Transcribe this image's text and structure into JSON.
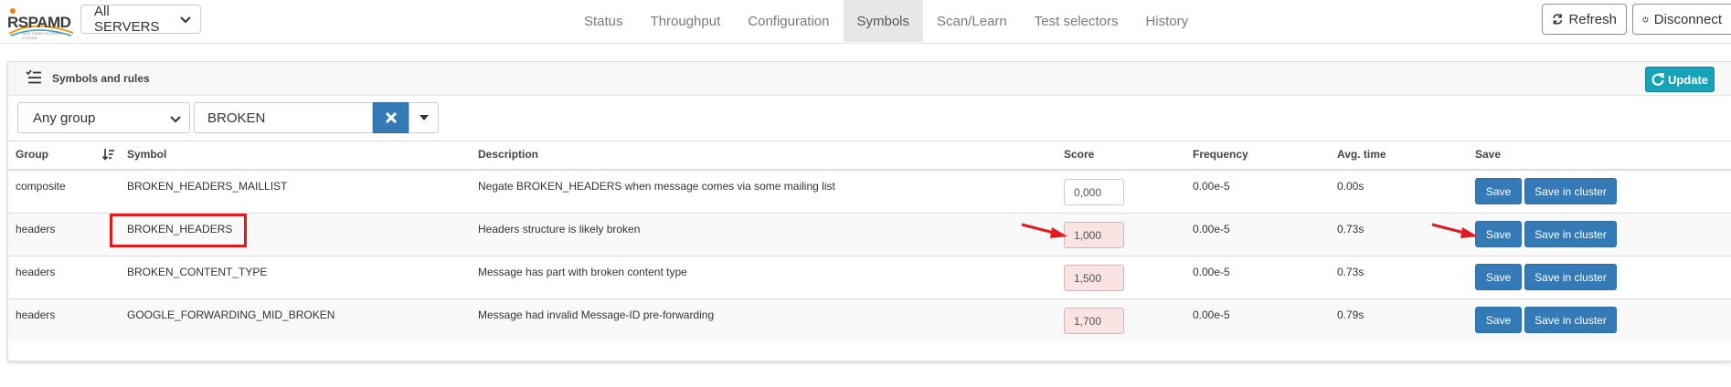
{
  "app": {
    "logo_text": "RSPAMD",
    "logo_sub": "FAST SPAM FILTERING SYSTEM"
  },
  "server_select": {
    "value": "All SERVERS"
  },
  "nav": {
    "tabs": [
      {
        "label": "Status"
      },
      {
        "label": "Throughput"
      },
      {
        "label": "Configuration"
      },
      {
        "label": "Symbols",
        "active": true
      },
      {
        "label": "Scan/Learn"
      },
      {
        "label": "Test selectors"
      },
      {
        "label": "History"
      }
    ],
    "refresh_label": "Refresh",
    "disconnect_label": "Disconnect"
  },
  "panel": {
    "title": "Symbols and rules",
    "update_label": "Update",
    "group_filter": "Any group",
    "search_value": "BROKEN"
  },
  "table": {
    "headers": {
      "group": "Group",
      "symbol": "Symbol",
      "description": "Description",
      "score": "Score",
      "frequency": "Frequency",
      "avg_time": "Avg. time",
      "save": "Save"
    },
    "save_label": "Save",
    "save_cluster_label": "Save in cluster",
    "rows": [
      {
        "group": "composite",
        "symbol": "BROKEN_HEADERS_MAILLIST",
        "description": "Negate BROKEN_HEADERS when message comes via some mailing list",
        "score": "0,000",
        "frequency": "0.00e-5",
        "avg_time": "0.00s"
      },
      {
        "group": "headers",
        "symbol": "BROKEN_HEADERS",
        "description": "Headers structure is likely broken",
        "score": "1,000",
        "frequency": "0.00e-5",
        "avg_time": "0.73s"
      },
      {
        "group": "headers",
        "symbol": "BROKEN_CONTENT_TYPE",
        "description": "Message has part with broken content type",
        "score": "1,500",
        "frequency": "0.00e-5",
        "avg_time": "0.73s"
      },
      {
        "group": "headers",
        "symbol": "GOOGLE_FORWARDING_MID_BROKEN",
        "description": "Message had invalid Message-ID pre-forwarding",
        "score": "1,700",
        "frequency": "0.00e-5",
        "avg_time": "0.79s"
      }
    ]
  },
  "colors": {
    "primary": "#337ab7",
    "info": "#17a2b8",
    "annotation": "#e2191c",
    "changed_bg": "#f9e3e3"
  }
}
